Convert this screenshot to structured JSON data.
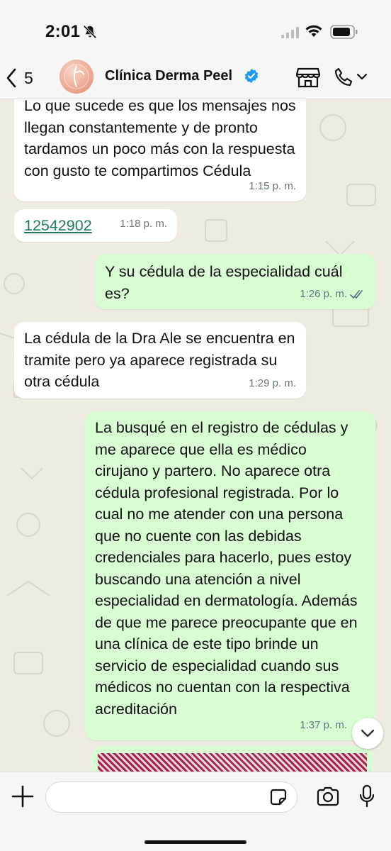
{
  "status_bar": {
    "time": "2:01"
  },
  "header": {
    "back_count": "5",
    "contact_name": "Clínica Derma Peel"
  },
  "messages": [
    {
      "direction": "in",
      "text": "Lo que sucede es que los mensajes nos llegan constantemente y de pronto tardamos un poco más con la respuesta con gusto te compartimos Cédula",
      "time": "1:15 p. m."
    },
    {
      "direction": "in",
      "text": "12542902",
      "time": "1:18 p. m."
    },
    {
      "direction": "out",
      "text": "Y su cédula de la especialidad cuál es?",
      "time": "1:26 p. m.",
      "status": "read"
    },
    {
      "direction": "in",
      "text": "La cédula de la Dra Ale se encuentra en tramite pero ya aparece registrada su otra cédula",
      "time": "1:29 p. m."
    },
    {
      "direction": "out",
      "text": "La busqué en el registro de cédulas y me aparece que ella es médico cirujano y partero. No aparece otra cédula profesional registrada. Por lo cual no me atender con una persona que no cuente con las debidas credenciales para hacerlo, pues estoy buscando una atención a nivel especialidad en dermatología. Además de que me parece preocupante que en una clínica de este tipo brinde un servicio de especialidad cuando sus médicos no cuentan con la respectiva acreditación",
      "time": "1:37 p. m."
    }
  ],
  "input": {
    "placeholder": "",
    "value": ""
  },
  "icons": {
    "back": "chevron-left-icon",
    "verified": "verified-badge-icon",
    "store": "storefront-icon",
    "call": "phone-icon",
    "plus": "plus-icon",
    "sticker": "sticker-icon",
    "camera": "camera-icon",
    "mic": "microphone-icon",
    "scroll": "chevron-down-icon"
  },
  "colors": {
    "incoming_bubble": "#ffffff",
    "outgoing_bubble": "#d9fdd3",
    "chat_background": "#efeae2",
    "verified_blue": "#1d9bf0",
    "link_green": "#1f7a5a",
    "read_ticks": "#667781"
  }
}
